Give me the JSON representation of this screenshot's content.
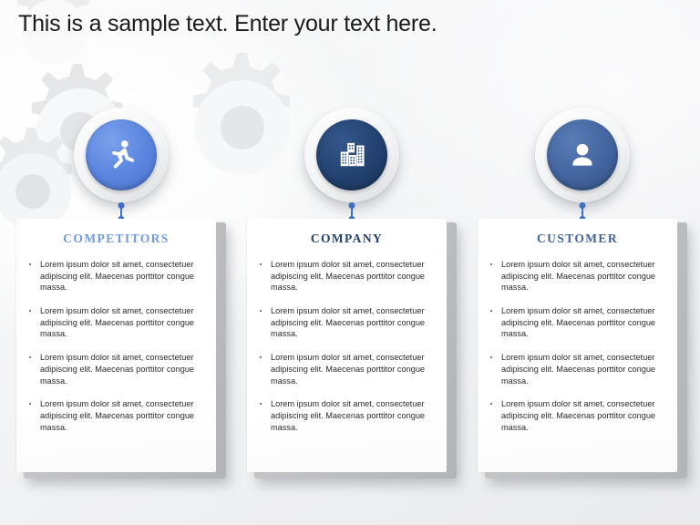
{
  "slide": {
    "title": "This is a sample text. Enter your text here.",
    "background": "gears-pattern",
    "bullet_text": "Lorem ipsum dolor sit amet, consectetuer adipiscing elit. Maecenas porttitor congue massa."
  },
  "colors": {
    "competitors": "#5b86e0",
    "company": "#22416f",
    "customer": "#42649f",
    "connector": "#3f6fc4",
    "title_text": "#1b1b1b",
    "body_text": "#2b2b2b",
    "card_face": "#ffffff",
    "card_side": "#bdc0c2"
  },
  "columns": [
    {
      "id": "competitors",
      "heading": "COMPETITORS",
      "heading_color": "#6f9ae2",
      "circle_color": "#5b86e0",
      "icon": "running-person-icon",
      "bullets": [
        "Lorem ipsum dolor sit amet, consectetuer adipiscing elit. Maecenas porttitor congue massa.",
        "Lorem ipsum dolor sit amet, consectetuer adipiscing elit. Maecenas porttitor congue massa.",
        "Lorem ipsum dolor sit amet, consectetuer adipiscing elit. Maecenas porttitor congue massa.",
        "Lorem ipsum dolor sit amet, consectetuer adipiscing elit. Maecenas porttitor congue massa."
      ]
    },
    {
      "id": "company",
      "heading": "COMPANY",
      "heading_color": "#22416f",
      "circle_color": "#22416f",
      "icon": "city-buildings-icon",
      "bullets": [
        "Lorem ipsum dolor sit amet, consectetuer adipiscing elit. Maecenas porttitor congue massa.",
        "Lorem ipsum dolor sit amet, consectetuer adipiscing elit. Maecenas porttitor congue massa.",
        "Lorem ipsum dolor sit amet, consectetuer adipiscing elit. Maecenas porttitor congue massa.",
        "Lorem ipsum dolor sit amet, consectetuer adipiscing elit. Maecenas porttitor congue massa."
      ]
    },
    {
      "id": "customer",
      "heading": "CUSTOMER",
      "heading_color": "#42649f",
      "circle_color": "#42649f",
      "icon": "person-user-icon",
      "bullets": [
        "Lorem ipsum dolor sit amet, consectetuer adipiscing elit. Maecenas porttitor congue massa.",
        "Lorem ipsum dolor sit amet, consectetuer adipiscing elit. Maecenas porttitor congue massa.",
        "Lorem ipsum dolor sit amet, consectetuer adipiscing elit. Maecenas porttitor congue massa.",
        "Lorem ipsum dolor sit amet, consectetuer adipiscing elit. Maecenas porttitor congue massa."
      ]
    }
  ]
}
